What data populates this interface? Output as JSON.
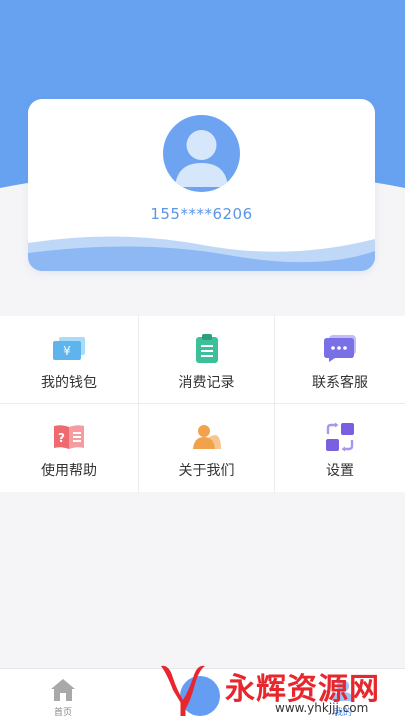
{
  "profile": {
    "phone": "155****6206"
  },
  "menu": [
    {
      "label": "我的钱包",
      "icon": "wallet-icon",
      "color": "#5fb4ee"
    },
    {
      "label": "消费记录",
      "icon": "clipboard-icon",
      "color": "#3dbf9a"
    },
    {
      "label": "联系客服",
      "icon": "chat-icon",
      "color": "#7a70e6"
    },
    {
      "label": "使用帮助",
      "icon": "help-book-icon",
      "color": "#ef6a6f"
    },
    {
      "label": "关于我们",
      "icon": "person-icon",
      "color": "#f2a24a"
    },
    {
      "label": "设置",
      "icon": "settings-swap-icon",
      "color": "#7a60e0"
    }
  ],
  "tabbar": {
    "home_label": "首页",
    "mine_label": "我的"
  },
  "watermark": {
    "title": "永辉资源网",
    "url": "www.yhkjjj.com"
  },
  "colors": {
    "primary": "#4a8cf0",
    "header": "#67a2f0",
    "accent_text": "#5b95e6"
  }
}
